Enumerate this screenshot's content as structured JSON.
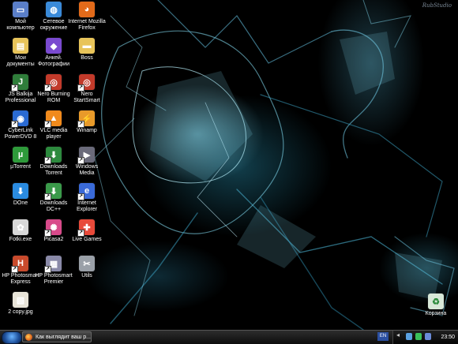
{
  "desktop": {
    "watermark": "RubStudio",
    "icons": [
      {
        "label": "Мой компьютер",
        "icon": "my-computer-icon",
        "color": "#5a7ec8",
        "glyph": "▭",
        "shortcut": false
      },
      {
        "label": "Мои документы",
        "icon": "my-documents-icon",
        "color": "#e8c45a",
        "glyph": "▤",
        "shortcut": false
      },
      {
        "label": "JS Balkija Professional",
        "icon": "js-balkija-icon",
        "color": "#2f7d3a",
        "glyph": "J",
        "shortcut": true
      },
      {
        "label": "CyberLink PowerDVD 8",
        "icon": "powerdvd-icon",
        "color": "#2a6ad2",
        "glyph": "◉",
        "shortcut": true
      },
      {
        "label": "µTorrent",
        "icon": "utorrent-icon",
        "color": "#2e9a3a",
        "glyph": "µ",
        "shortcut": false
      },
      {
        "label": "DOne",
        "icon": "done-icon",
        "color": "#2a8be0",
        "glyph": "⬇",
        "shortcut": false
      },
      {
        "label": "Fotki.exe",
        "icon": "fotki-icon",
        "color": "#d8d8d8",
        "glyph": "✿",
        "shortcut": false
      },
      {
        "label": "HP Photosmart Express",
        "icon": "hp-photosmart-express-icon",
        "color": "#c84a2c",
        "glyph": "H",
        "shortcut": true
      },
      {
        "label": "2 copy.jpg",
        "icon": "jpg-file-icon",
        "color": "#e8e4d8",
        "glyph": "▧",
        "shortcut": false
      },
      {
        "label": "Сетевое окружение",
        "icon": "network-places-icon",
        "color": "#3a8ad8",
        "glyph": "◍",
        "shortcut": false
      },
      {
        "label": "Анкей. Фотографии",
        "icon": "photos-icon",
        "color": "#7a4ad0",
        "glyph": "◆",
        "shortcut": false
      },
      {
        "label": "Nero Burning ROM",
        "icon": "nero-burning-rom-icon",
        "color": "#c23a2a",
        "glyph": "◎",
        "shortcut": true
      },
      {
        "label": "VLC media player",
        "icon": "vlc-icon",
        "color": "#f08a1c",
        "glyph": "▲",
        "shortcut": true
      },
      {
        "label": "Downloads Torrent",
        "icon": "downloads-torrent-icon",
        "color": "#2d8a3e",
        "glyph": "⬇",
        "shortcut": true
      },
      {
        "label": "Downloads DC++",
        "icon": "downloads-dc-icon",
        "color": "#3a9a4a",
        "glyph": "⬇",
        "shortcut": true
      },
      {
        "label": "Picasa2",
        "icon": "picasa-icon",
        "color": "#d84a8a",
        "glyph": "✺",
        "shortcut": true
      },
      {
        "label": "HP Photosmart Premier",
        "icon": "hp-photosmart-premier-icon",
        "color": "#8a8aa8",
        "glyph": "▦",
        "shortcut": true
      },
      {
        "label": "Internet Mozilla Firefox",
        "icon": "firefox-icon",
        "color": "#e26a1a",
        "glyph": "◕",
        "shortcut": false
      },
      {
        "label": "Boss",
        "icon": "boss-folder-icon",
        "color": "#e8c45a",
        "glyph": "▬",
        "shortcut": false
      },
      {
        "label": "Nero StartSmart",
        "icon": "nero-startsmart-icon",
        "color": "#c23a2a",
        "glyph": "◎",
        "shortcut": true
      },
      {
        "label": "Winamp",
        "icon": "winamp-icon",
        "color": "#e89a2a",
        "glyph": "⚡",
        "shortcut": true
      },
      {
        "label": "Windows Media",
        "icon": "windows-media-icon",
        "color": "#6a6a7a",
        "glyph": "▶",
        "shortcut": true
      },
      {
        "label": "Internet Explorer",
        "icon": "internet-explorer-icon",
        "color": "#3a6ad8",
        "glyph": "e",
        "shortcut": true
      },
      {
        "label": "Live Games",
        "icon": "live-games-icon",
        "color": "#e84a3a",
        "glyph": "✚",
        "shortcut": true
      },
      {
        "label": "Utils",
        "icon": "utils-folder-icon",
        "color": "#9aa0a8",
        "glyph": "✂",
        "shortcut": false
      },
      {
        "label": "Корзина",
        "icon": "recycle-bin-icon",
        "color": "#d8e8d8",
        "glyph": "♻",
        "shortcut": false
      }
    ]
  },
  "taskbar": {
    "task_label": "Как выглядит ваш р...",
    "language": "EN",
    "clock": "23:50"
  }
}
